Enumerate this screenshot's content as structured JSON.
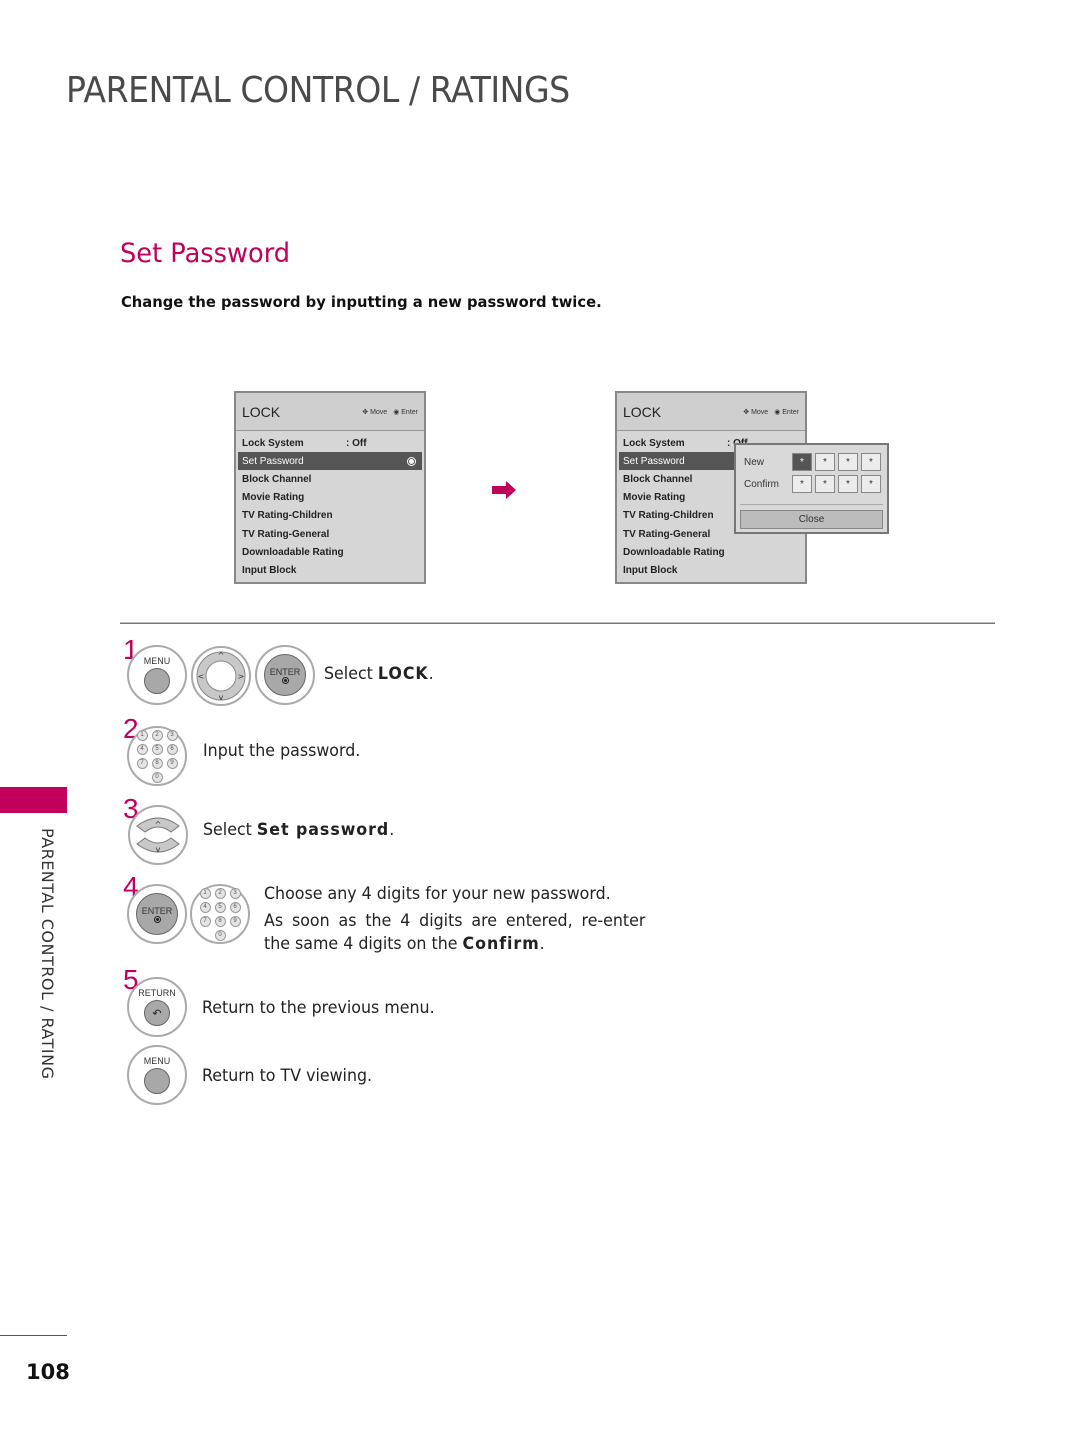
{
  "header": {
    "title": "PARENTAL CONTROL / RATINGS"
  },
  "section": {
    "title": "Set Password",
    "intro": "Change the password by inputting a new password twice."
  },
  "osd_before": {
    "title": "LOCK",
    "hint_move": "Move",
    "hint_enter": "Enter",
    "items": [
      {
        "label": "Lock System",
        "value": ": Off"
      },
      {
        "label": "Set Password",
        "selected": true
      },
      {
        "label": "Block Channel"
      },
      {
        "label": "Movie Rating"
      },
      {
        "label": "TV Rating-Children"
      },
      {
        "label": "TV Rating-General"
      },
      {
        "label": "Downloadable Rating"
      },
      {
        "label": "Input Block"
      }
    ]
  },
  "osd_after": {
    "title": "LOCK",
    "hint_move": "Move",
    "hint_enter": "Enter",
    "items": [
      {
        "label": "Lock System",
        "value": ": Off"
      },
      {
        "label": "Set Password",
        "selected": true
      },
      {
        "label": "Block Channel"
      },
      {
        "label": "Movie Rating"
      },
      {
        "label": "TV Rating-Children"
      },
      {
        "label": "TV Rating-General"
      },
      {
        "label": "Downloadable Rating"
      },
      {
        "label": "Input Block"
      }
    ],
    "popup": {
      "new_label": "New",
      "confirm_label": "Confirm",
      "mask_char": "*",
      "close_label": "Close"
    }
  },
  "steps": [
    {
      "num": "1",
      "text_pre": "Select ",
      "text_bold": "LOCK",
      "text_post": ".",
      "buttons": [
        "MENU",
        "NAV",
        "ENTER"
      ]
    },
    {
      "num": "2",
      "text": "Input the password.",
      "buttons": [
        "NUMPAD"
      ]
    },
    {
      "num": "3",
      "text_pre": "Select ",
      "text_bold": "Set password",
      "text_post": ".",
      "buttons": [
        "UPDOWN"
      ]
    },
    {
      "num": "4",
      "line1": "Choose any 4 digits for your new password.",
      "line2": "As soon as the 4 digits are entered, re-enter",
      "line3_pre": "the same 4 digits on the ",
      "line3_bold": "Confirm",
      "line3_post": ".",
      "buttons": [
        "ENTER",
        "NUMPAD"
      ]
    },
    {
      "num": "5",
      "text": "Return to the previous menu.",
      "buttons": [
        "RETURN"
      ]
    },
    {
      "num": "",
      "text": "Return to TV viewing.",
      "buttons": [
        "MENU"
      ]
    }
  ],
  "buttons": {
    "menu": "MENU",
    "enter": "ENTER",
    "return": "RETURN"
  },
  "keypad": [
    "1",
    "2",
    "3",
    "4",
    "5",
    "6",
    "7",
    "8",
    "9",
    "0"
  ],
  "sidebar": {
    "label": "PARENTAL CONTROL / RATING"
  },
  "footer": {
    "page_number": "108"
  },
  "colors": {
    "accent": "#c0005a",
    "osd_bg": "#d6d6d6",
    "osd_selected": "#555555"
  }
}
